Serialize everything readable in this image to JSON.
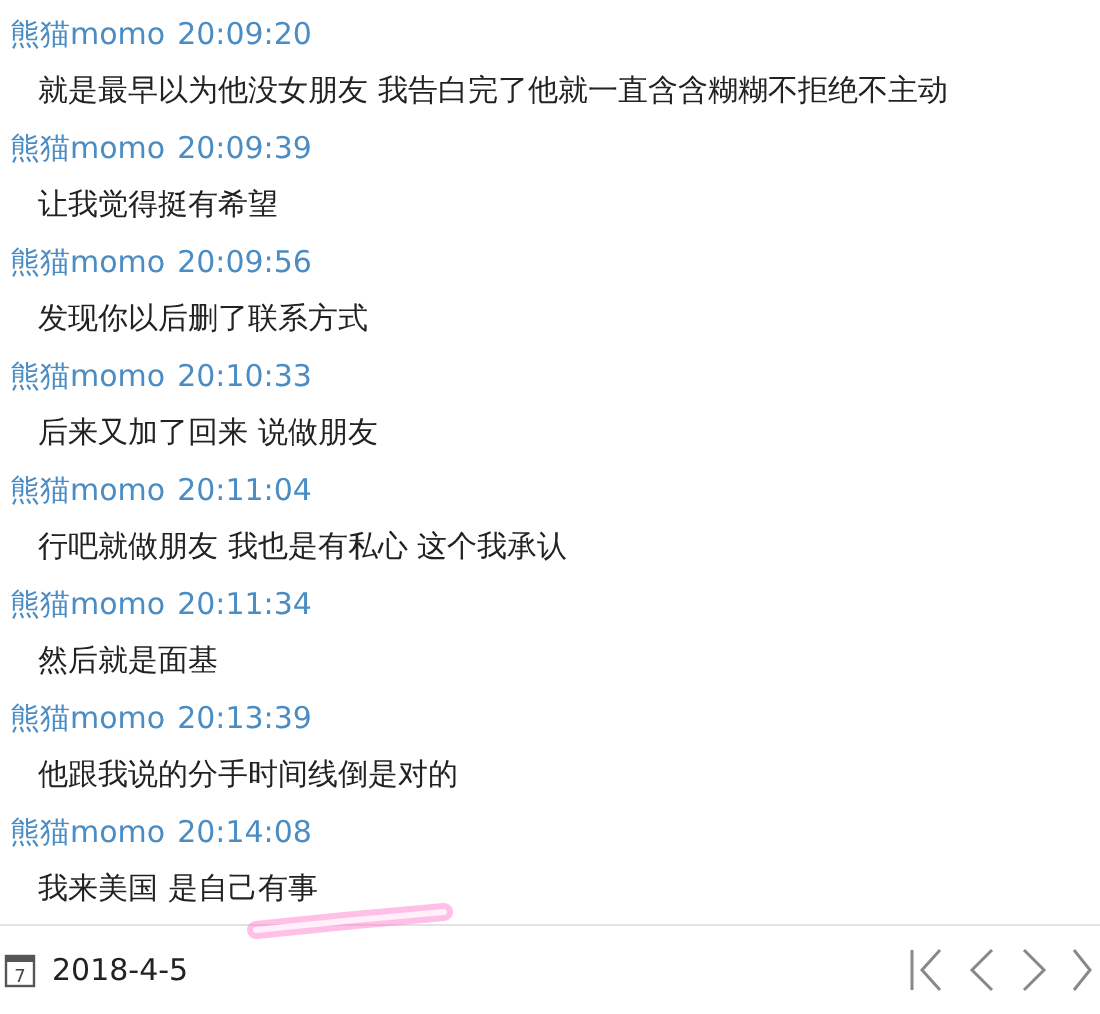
{
  "messages": [
    {
      "sender": "熊猫momo",
      "time": "20:09:20",
      "text": "就是最早以为他没女朋友 我告白完了他就一直含含糊糊不拒绝不主动"
    },
    {
      "sender": "熊猫momo",
      "time": "20:09:39",
      "text": "让我觉得挺有希望"
    },
    {
      "sender": "熊猫momo",
      "time": "20:09:56",
      "text": "发现你以后删了联系方式"
    },
    {
      "sender": "熊猫momo",
      "time": "20:10:33",
      "text": "后来又加了回来 说做朋友"
    },
    {
      "sender": "熊猫momo",
      "time": "20:11:04",
      "text": "行吧就做朋友 我也是有私心 这个我承认"
    },
    {
      "sender": "熊猫momo",
      "time": "20:11:34",
      "text": "然后就是面基"
    },
    {
      "sender": "熊猫momo",
      "time": "20:13:39",
      "text": "他跟我说的分手时间线倒是对的"
    },
    {
      "sender": "熊猫momo",
      "time": "20:14:08",
      "text": "我来美国 是自己有事"
    }
  ],
  "footer": {
    "calendar_day": "7",
    "date": "2018-4-5"
  }
}
